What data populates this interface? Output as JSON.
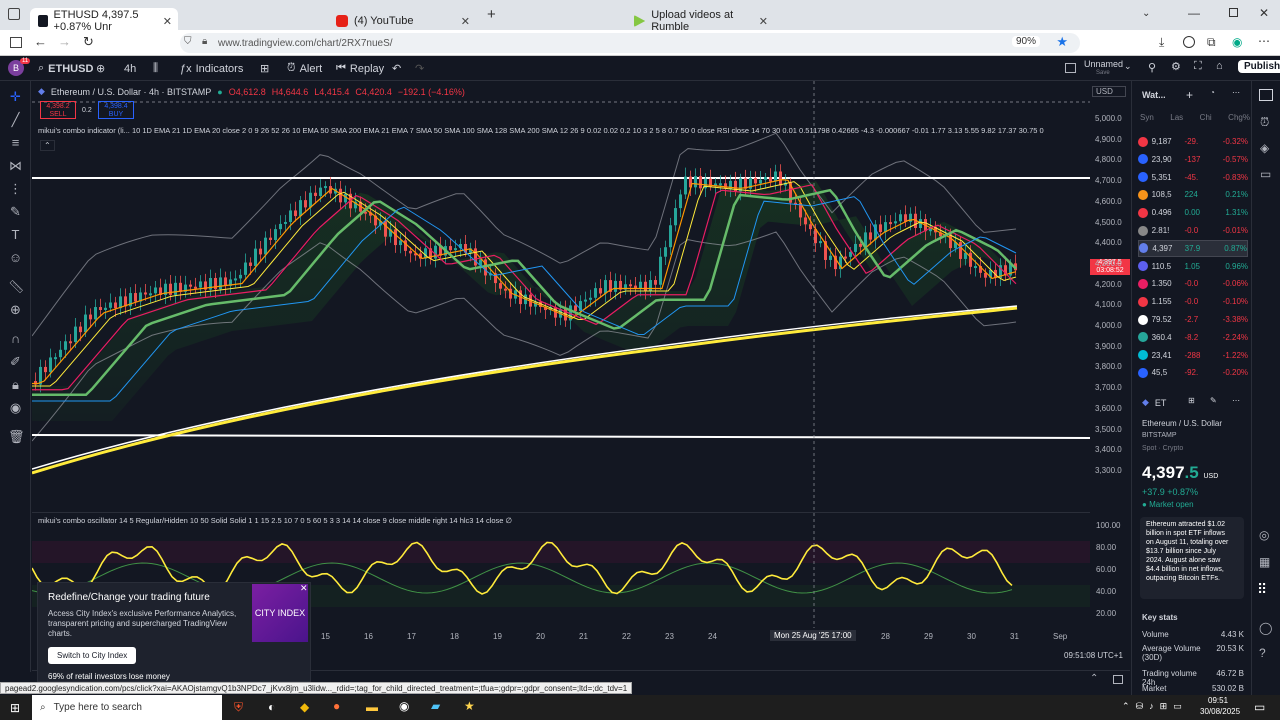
{
  "browser": {
    "tabs": [
      {
        "label": "ETHUSD 4,397.5 +0.87% Unr",
        "icon": "tradingview-icon",
        "active": true
      },
      {
        "label": "(4) YouTube",
        "icon": "youtube-icon",
        "active": false
      },
      {
        "label": "Upload videos at Rumble",
        "icon": "rumble-icon",
        "active": false
      }
    ],
    "new_tab": "+",
    "url": "www.tradingview.com/chart/2RX7nueS/",
    "zoom": "90%"
  },
  "toolbar": {
    "symbol": "ETHUSD",
    "interval": "4h",
    "indicators": "Indicators",
    "alert": "Alert",
    "replay": "Replay",
    "layout_name": "Unnamed",
    "layout_sub": "Save",
    "publish": "Publish",
    "avatar_letter": "B",
    "notif_count": "11"
  },
  "chart": {
    "title": "Ethereum / U.S. Dollar · 4h · BITSTAMP",
    "ohlc": {
      "o": "O4,612.8",
      "h": "H4,644.6",
      "l": "L4,415.4",
      "c": "C4,420.4",
      "chg": "−192.1 (−4.16%)"
    },
    "sell_price": "4,398.2",
    "sell_label": "SELL",
    "spread": "0.2",
    "buy_price": "4,398.4",
    "buy_label": "BUY",
    "currency": "USD",
    "indicator1": "mikui's combo indicator (li...   10 1D EMA 21 1D EMA 20 close 2 0 9 26 52 26 10 EMA 50 SMA 200 EMA 21 EMA 7 SMA 50 SMA 100 SMA 128 SMA 200 SMA 12 26 9 0.02 0.02 0.2 10 3 2 5 8 0.7 50 0 close RSI close 14 70 30 0.01 0.511798 0.42665 -4.3 -0.000667 -0.01 1.77 3.13 5.55 9.82 17.37 30.75 0",
    "indicator2": "mikui's combo oscillator 14 5 Regular/Hidden 10 50 Solid Solid 1 1 15 2.5 10 7 0 5 60 5 3 3 14 14 close 9 close middle right 14 hlc3 14 close  ∅",
    "price_tag": "4,397.5",
    "price_tag_time": "03:08:52",
    "price_ticks": [
      "5,000.0",
      "4,900.0",
      "4,800.0",
      "4,700.0",
      "4,600.0",
      "4,500.0",
      "4,400.0",
      "4,300.0",
      "4,200.0",
      "4,100.0",
      "4,000.0",
      "3,900.0",
      "3,800.0",
      "3,700.0",
      "3,600.0",
      "3,500.0",
      "3,400.0",
      "3,300.0"
    ],
    "osc_ticks": [
      "100.00",
      "80.00",
      "60.00",
      "40.00",
      "20.00"
    ],
    "date_ticks": [
      "15",
      "16",
      "17",
      "18",
      "19",
      "20",
      "21",
      "22",
      "23",
      "24",
      "27",
      "28",
      "29",
      "30",
      "31",
      "Sep"
    ],
    "crosshair_date": "Mon 25 Aug '25  17:00",
    "clock": "09:51:08 UTC+1"
  },
  "watchlist": {
    "title": "Wat...",
    "cols": [
      "Syn",
      "Las",
      "Chi",
      "Chg%"
    ],
    "rows": [
      {
        "last": "9,187",
        "chg": "-29.",
        "pct": "-0.32%",
        "color": "#f23645"
      },
      {
        "last": "23,90",
        "chg": "-137",
        "pct": "-0.57%",
        "color": "#f23645"
      },
      {
        "last": "5,351",
        "chg": "-45.",
        "pct": "-0.83%",
        "color": "#f23645"
      },
      {
        "last": "108,5",
        "chg": "224",
        "pct": "0.21%",
        "color": "#22ab94"
      },
      {
        "last": "0.496",
        "chg": "0.00",
        "pct": "1.31%",
        "color": "#22ab94"
      },
      {
        "last": "2.81!",
        "chg": "-0.0",
        "pct": "-0.01%",
        "color": "#f23645"
      },
      {
        "last": "4,397",
        "chg": "37.9",
        "pct": "0.87%",
        "color": "#22ab94"
      },
      {
        "last": "110.5",
        "chg": "1.05",
        "pct": "0.96%",
        "color": "#22ab94"
      },
      {
        "last": "1.350",
        "chg": "-0.0",
        "pct": "-0.06%",
        "color": "#f23645"
      },
      {
        "last": "1.155",
        "chg": "-0.0",
        "pct": "-0.10%",
        "color": "#f23645"
      },
      {
        "last": "79.52",
        "chg": "-2.7",
        "pct": "-3.38%",
        "color": "#f23645"
      },
      {
        "last": "360.4",
        "chg": "-8.2",
        "pct": "-2.24%",
        "color": "#f23645"
      },
      {
        "last": "23,41",
        "chg": "-288",
        "pct": "-1.22%",
        "color": "#f23645"
      },
      {
        "last": "45,5",
        "chg": "-92.",
        "pct": "-0.20%",
        "color": "#f23645"
      }
    ]
  },
  "details": {
    "symbol": "ET",
    "name": "Ethereum / U.S. Dollar",
    "exchange": "BITSTAMP",
    "type": "Spot · Crypto",
    "price_main": "4,397",
    "price_dec": ".5",
    "currency": "USD",
    "change": "+37.9  +0.87%",
    "market": "Market open",
    "news": "Ethereum attracted $1.02 billion in spot ETF inflows on August 11, totaling over $13.7 billion since July 2024. August alone saw $4.4 billion in net inflows, outpacing Bitcoin ETFs.",
    "key_stats": "Key stats",
    "stats": [
      {
        "label": "Volume",
        "value": "4.43 K"
      },
      {
        "label": "Average Volume (30D)",
        "value": "20.53 K"
      },
      {
        "label": "Trading volume 24h",
        "value": "46.72 B"
      },
      {
        "label": "Market",
        "value": "530.02 B"
      }
    ]
  },
  "ad": {
    "title": "Redefine/Change your trading future",
    "body": "Access City Index's exclusive Performance Analytics, transparent pricing and supercharged TradingView charts.",
    "button": "Switch to City Index",
    "logo": "CITY INDEX",
    "foot": "69% of retail investors lose money"
  },
  "status_url": "pagead2.googlesyndication.com/pcs/click?xai=AKAOjstamgvQ1b3NPDc7_jKvx8jm_u3lidw..._rdid=;tag_for_child_directed_treatment=;tfua=;gdpr=;gdpr_consent=;ltd=;dc_tdv=1",
  "taskbar": {
    "search": "Type here to search",
    "time": "09:51",
    "date": "30/08/2025"
  }
}
